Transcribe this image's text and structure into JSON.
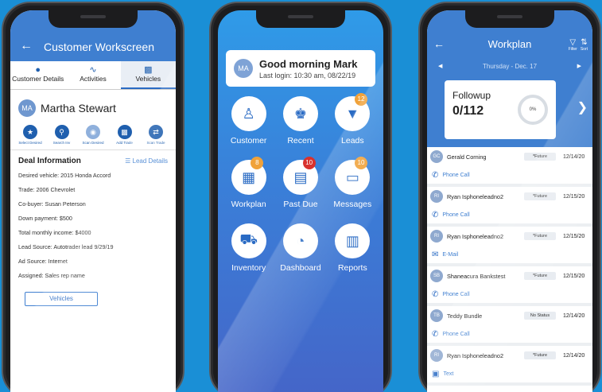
{
  "phone1": {
    "header_title": "Customer Workscreen",
    "back_icon": "arrow-left-icon",
    "tabs": [
      {
        "label": "Customer Details",
        "icon": "person-icon"
      },
      {
        "label": "Activities",
        "icon": "activity-icon"
      },
      {
        "label": "Vehicles",
        "icon": "car-icon"
      }
    ],
    "avatar_initials": "MA",
    "customer_name": "Martha Stewart",
    "actions": [
      {
        "label": "Select Desired"
      },
      {
        "label": "Search Inv"
      },
      {
        "label": "Scan Desired"
      },
      {
        "label": "Add Trade"
      },
      {
        "label": "Scan Trade"
      }
    ],
    "deal": {
      "title": "Deal Information",
      "lead_details": "Lead Details",
      "lines": [
        "Desired vehicle: 2015 Honda Accord",
        "Trade: 2006 Chevrolet",
        "Co-buyer: Susan Peterson",
        "Down payment: $500",
        "Total monthly income: $4000",
        "Lead Source: Autotrader lead 9/29/19",
        "Ad Source: Internet",
        "Assigned: Sales rep name"
      ],
      "vehicles_button": "Vehicles"
    }
  },
  "phone2": {
    "avatar_initials": "MA",
    "greeting": "Good morning Mark",
    "last_login": "Last login: 10:30 am, 08/22/19",
    "tiles": [
      {
        "label": "Customer",
        "icon": "customers-icon",
        "badge": ""
      },
      {
        "label": "Recent",
        "icon": "recent-icon",
        "badge": ""
      },
      {
        "label": "Leads",
        "icon": "funnel-icon",
        "badge": "12"
      },
      {
        "label": "Workplan",
        "icon": "calendar-icon",
        "badge": "8"
      },
      {
        "label": "Past Due",
        "icon": "past-due-icon",
        "badge": "10"
      },
      {
        "label": "Messages",
        "icon": "messages-icon",
        "badge": "10"
      },
      {
        "label": "Inventory",
        "icon": "car-money-icon",
        "badge": ""
      },
      {
        "label": "Dashboard",
        "icon": "dashboard-icon",
        "badge": ""
      },
      {
        "label": "Reports",
        "icon": "reports-icon",
        "badge": ""
      }
    ]
  },
  "phone3": {
    "header_title": "Workplan",
    "filter_label": "Filter",
    "sort_label": "Sort",
    "date": "Thursday - Dec. 17",
    "followup_label": "Followup",
    "followup_value": "0/112",
    "followup_percent": "0%",
    "rows": [
      {
        "initials": "GC",
        "name": "Gerald Corning",
        "status": "*Future",
        "date": "12/14/20",
        "action": "Phone Call",
        "action_icon": "phone-icon"
      },
      {
        "initials": "RI",
        "name": "Ryan Isphoneleadno2",
        "status": "*Future",
        "date": "12/15/20",
        "action": "Phone Call",
        "action_icon": "phone-icon"
      },
      {
        "initials": "RI",
        "name": "Ryan Isphoneleadno2",
        "status": "*Future",
        "date": "12/15/20",
        "action": "E-Mail",
        "action_icon": "mail-icon"
      },
      {
        "initials": "SB",
        "name": "Shaneacura Bankstest",
        "status": "*Future",
        "date": "12/15/20",
        "action": "Phone Call",
        "action_icon": "phone-icon"
      },
      {
        "initials": "TB",
        "name": "Teddy Bundle",
        "status": "No Status",
        "date": "12/14/20",
        "action": "Phone Call",
        "action_icon": "phone-icon"
      },
      {
        "initials": "RI",
        "name": "Ryan Isphoneleadno2",
        "status": "*Future",
        "date": "12/14/20",
        "action": "Text",
        "action_icon": "text-icon"
      }
    ]
  }
}
